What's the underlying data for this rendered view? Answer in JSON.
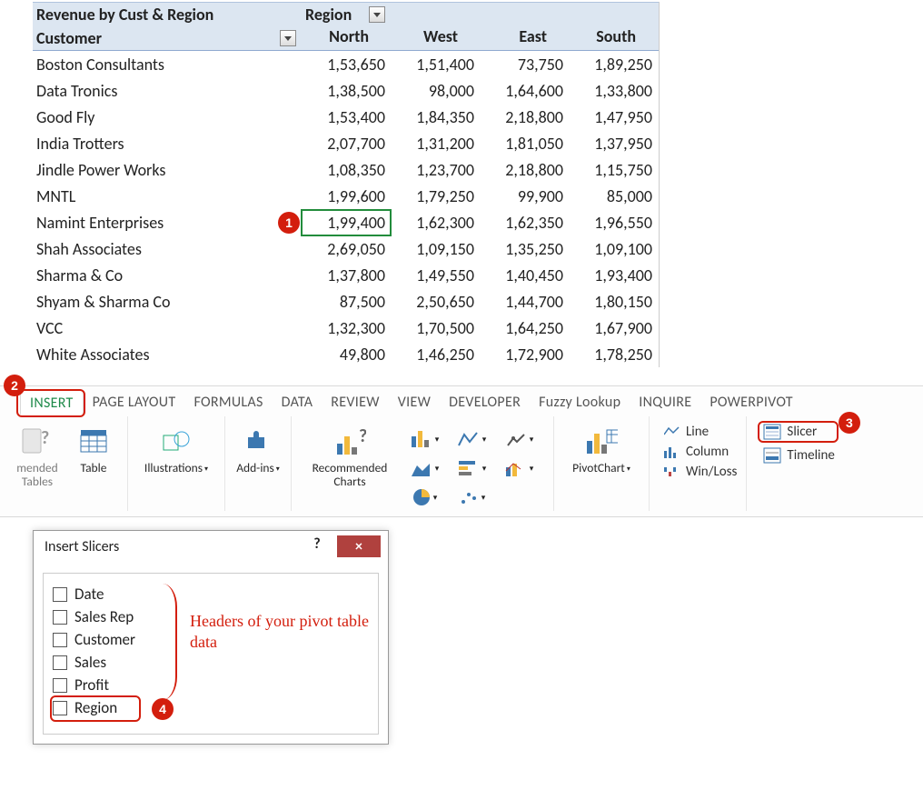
{
  "pivot": {
    "title_left": "Revenue by Cust & Region",
    "title_right": "Region",
    "col_customer": "Customer",
    "columns": [
      "North",
      "West",
      "East",
      "South"
    ],
    "rows": [
      {
        "customer": "Boston Consultants",
        "values": [
          "1,53,650",
          "1,51,400",
          "73,750",
          "1,89,250"
        ]
      },
      {
        "customer": "Data Tronics",
        "values": [
          "1,38,500",
          "98,000",
          "1,64,600",
          "1,33,800"
        ]
      },
      {
        "customer": "Good Fly",
        "values": [
          "1,53,400",
          "1,84,350",
          "2,18,800",
          "1,47,950"
        ]
      },
      {
        "customer": "India Trotters",
        "values": [
          "2,07,700",
          "1,31,200",
          "1,81,050",
          "1,37,950"
        ]
      },
      {
        "customer": "Jindle Power Works",
        "values": [
          "1,08,350",
          "1,23,700",
          "2,18,800",
          "1,15,750"
        ]
      },
      {
        "customer": "MNTL",
        "values": [
          "1,99,600",
          "1,79,250",
          "99,900",
          "85,000"
        ]
      },
      {
        "customer": "Namint Enterprises",
        "values": [
          "1,99,400",
          "1,62,300",
          "1,62,350",
          "1,96,550"
        ]
      },
      {
        "customer": "Shah Associates",
        "values": [
          "2,69,050",
          "1,09,150",
          "1,35,250",
          "1,09,100"
        ]
      },
      {
        "customer": "Sharma & Co",
        "values": [
          "1,37,800",
          "1,49,550",
          "1,40,450",
          "1,93,400"
        ]
      },
      {
        "customer": "Shyam & Sharma Co",
        "values": [
          "87,500",
          "2,50,650",
          "1,44,700",
          "1,80,150"
        ]
      },
      {
        "customer": "VCC",
        "values": [
          "1,32,300",
          "1,70,500",
          "1,64,250",
          "1,67,900"
        ]
      },
      {
        "customer": "White Associates",
        "values": [
          "49,800",
          "1,46,250",
          "1,72,900",
          "1,78,250"
        ]
      }
    ],
    "selected_cell_value": "1,99,400",
    "selected_row_index": 6,
    "selected_col_index": 0
  },
  "ribbon": {
    "tabs": [
      "INSERT",
      "PAGE LAYOUT",
      "FORMULAS",
      "DATA",
      "REVIEW",
      "VIEW",
      "DEVELOPER",
      "Fuzzy Lookup",
      "INQUIRE",
      "POWERPIVOT"
    ],
    "active_tab_index": 0,
    "btn_recommended_tables": "mended Tables",
    "btn_table": "Table",
    "btn_illustrations": "Illustrations",
    "btn_addins": "Add-ins",
    "btn_recommended_charts": "Recommended Charts",
    "btn_pivotchart": "PivotChart",
    "spark_line": "Line",
    "spark_column": "Column",
    "spark_winloss": "Win/Loss",
    "filter_slicer": "Slicer",
    "filter_timeline": "Timeline"
  },
  "dialog": {
    "title": "Insert Slicers",
    "fields": [
      "Date",
      "Sales Rep",
      "Customer",
      "Sales",
      "Profit",
      "Region"
    ],
    "highlight_index": 5
  },
  "annotation_text": "Headers of your pivot table data",
  "callouts": {
    "1": "1",
    "2": "2",
    "3": "3",
    "4": "4"
  }
}
